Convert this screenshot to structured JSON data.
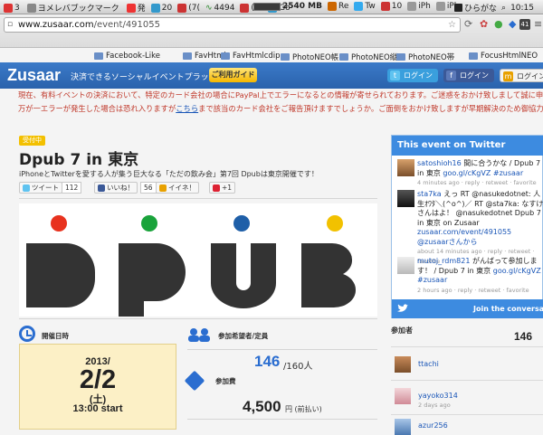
{
  "menubar": {
    "tabs": [
      "3",
      "ヨメレバブックマーク",
      "発",
      "20",
      "(7(",
      "4494",
      "(7(",
      "Go",
      "Re",
      "Tw",
      "10",
      "iPh",
      "iPh"
    ],
    "memory": "2540 MB",
    "input_mode": "ひらがな",
    "clock": "10:15"
  },
  "browser": {
    "url_domain": "www.zusaar.com",
    "url_path": "/event/491055",
    "badge_count": "41",
    "bookmarks": [
      "Facebook-Like",
      "FavHtml",
      "FavHtmlcdip",
      "PhotoNEO帳",
      "PhotoNEO縦",
      "PhotoNEO帯",
      "FocusHtmlNEO"
    ]
  },
  "header": {
    "logo": "Zusaar",
    "tagline": "決済できるソーシャルイベントプラットフォーム",
    "guide_button": "ご利用ガイド",
    "login_label": "ログイン",
    "accent": "#2a6dd0"
  },
  "notice": {
    "line1": "現在、有料イベントの決済において、特定のカード会社の場合にPayPal上でエラーになるとの情報が寄せられております。ご迷惑をおかけ致しまして誠に申し訳ありません",
    "line2_before": "万が一エラーが発生した場合は恐れ入りますが",
    "line2_link": "こちら",
    "line2_after": "まで該当のカード会社をご報告頂けますでしょうか。ご面倒をおかけ致しますが早期解決のため御協力頂けますと幸いで"
  },
  "event": {
    "status": "受付中",
    "title": "Dpub 7 in 東京",
    "subtitle": "iPhoneとTwitterを愛する人が集う巨大なる「ただの飲み会」第7回 Dpubは東京開催です！",
    "share": {
      "tweet_label": "ツイート",
      "tweet_count": "112",
      "like_label": "いいね！",
      "like_count": "56",
      "iine_label": "イイネ！",
      "gplus_label": "+1"
    },
    "banner_letters": [
      "D",
      "P",
      "U",
      "B"
    ],
    "banner_colors": [
      "#e8321e",
      "#1aa33b",
      "#1f5fa8",
      "#f2c100"
    ],
    "date_label": "開催日時",
    "date_year": "2013/",
    "date_day": "2/2",
    "date_weekday": "(土)",
    "date_time": "13:00  start",
    "attendees_label": "参加希望者/定員",
    "attendees_count": "146",
    "attendees_max": "/160人",
    "fee_label": "参加費",
    "fee": "4,500",
    "fee_unit": "円 (前払い)"
  },
  "twitter": {
    "heading": "This event on Twitter",
    "tweets": [
      {
        "user": "satoshioh16",
        "text": "間に合うかな / Dpub 7 in 東京",
        "link": "goo.gl/cKgVZ #zusaar",
        "meta": "4 minutes ago · reply · retweet · favorite"
      },
      {
        "user": "sta7ka",
        "text": "えっ RT @nasukedotnet: 人生ｵﾜﾀ＼(^o^)／ RT @sta7ka: なすけさんはよ！ @nasukedotnet Dpub 7 in 東京 on Zusaar",
        "link": "zusaar.com/event/491055 @zusaarさんから",
        "meta": "about 14 minutes ago · reply · retweet · favorite"
      },
      {
        "user": "mutoj_rdm821",
        "text": "がんばって参加します！ / Dpub 7 in 東京",
        "link": "goo.gl/cKgVZ #zusaar",
        "meta": "2 hours ago · reply · retweet · favorite"
      }
    ],
    "join": "Join the conversation"
  },
  "participants": {
    "label": "参加者",
    "count": "146",
    "users": [
      "ttachi",
      "yayoko314",
      "azur256"
    ],
    "meta": "2 days ago"
  }
}
